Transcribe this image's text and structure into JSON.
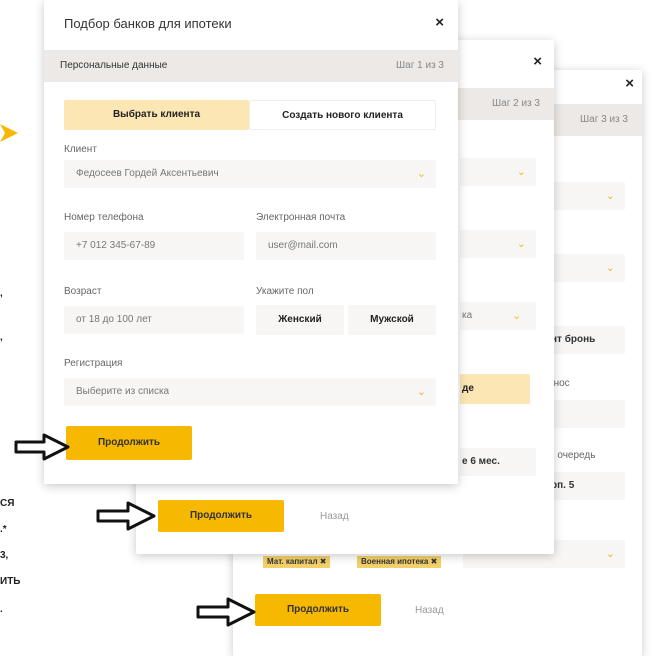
{
  "step1": {
    "title": "Подбор банков для ипотеки",
    "close": "×",
    "section": "Персональные данные",
    "step": "Шаг 1 из 3",
    "client_toggle": {
      "select_label": "Выбрать клиента",
      "create_label": "Создать нового клиента"
    },
    "client": {
      "label": "Клиент",
      "value": "Федосеев Гордей Аксентьевич"
    },
    "phone": {
      "label": "Номер телефона",
      "placeholder": "+7 012 345-67-89"
    },
    "email": {
      "label": "Электронная почта",
      "placeholder": "user@mail.com"
    },
    "age": {
      "label": "Возраст",
      "placeholder": "от 18 до 100 лет"
    },
    "gender": {
      "label": "Укажите пол",
      "female": "Женский",
      "male": "Мужской"
    },
    "registration": {
      "label": "Регистрация",
      "placeholder": "Выберите из списка"
    },
    "continue_label": "Продолжить"
  },
  "step2": {
    "close": "×",
    "step": "Шаг 2 из 3",
    "partial_1": "ка",
    "partial_2": "де",
    "partial_3": "е 6 мес.",
    "continue_label": "Продолжить",
    "back_label": "Назад"
  },
  "step3": {
    "close": "×",
    "step": "Шаг 3 из 3",
    "partial_1": "нт бронь",
    "partial_2": "знос",
    "partial_3": "й очередь",
    "partial_4": "рп. 5",
    "chip_1": "Мат. капитал ✖",
    "chip_2": "Военная ипотека ✖",
    "continue_label": "Продолжить",
    "back_label": "Назад"
  },
  "left_fragments": [
    ",",
    ",",
    "СЯ",
    ".*",
    "3,",
    "ИТЬ",
    "."
  ],
  "colors": {
    "accent": "#f6b800",
    "accent_light": "#fbe6b4",
    "stepbar": "#ece9e6"
  },
  "icons": [
    "close-icon",
    "chevron-down-icon",
    "pointer-arrow-icon",
    "yellow-arrow-icon"
  ]
}
